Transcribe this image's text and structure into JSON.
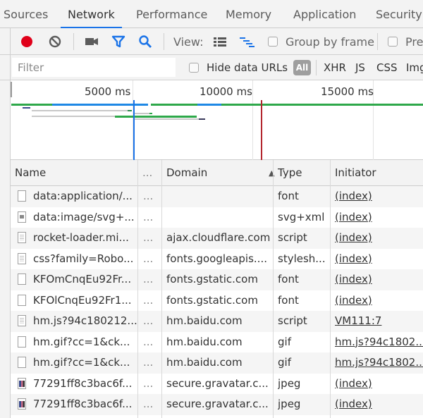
{
  "tabs": [
    {
      "label": "Sources",
      "active": false
    },
    {
      "label": "Network",
      "active": true
    },
    {
      "label": "Performance",
      "active": false
    },
    {
      "label": "Memory",
      "active": false
    },
    {
      "label": "Application",
      "active": false
    },
    {
      "label": "Security",
      "active": false
    }
  ],
  "toolbar": {
    "record_icon": "record-icon",
    "clear_icon": "clear-icon",
    "capture_icon": "camera-icon",
    "filter_icon": "filter-icon",
    "search_icon": "search-icon",
    "view_label": "View:",
    "large_rows_icon": "list-view-icon",
    "waterfall_icon": "waterfall-icon",
    "group_by_frame_label": "Group by frame",
    "group_by_frame_checked": false,
    "preserve_log_label": "Pre",
    "preserve_log_checked": false,
    "colors": {
      "record": "#e0001a",
      "accent": "#1a73e8"
    }
  },
  "filterbar": {
    "filter_placeholder": "Filter",
    "filter_value": "",
    "hide_data_urls_label": "Hide data URLs",
    "hide_data_urls_checked": false,
    "types": [
      "All",
      "XHR",
      "JS",
      "CSS",
      "Img"
    ],
    "selected_type": "All"
  },
  "overview": {
    "tick_labels": [
      "5000 ms",
      "10000 ms",
      "15000 ms"
    ],
    "dom_content_loaded_color": "#1a73e8",
    "load_color": "#b3262e"
  },
  "table": {
    "columns": [
      "Name",
      "...",
      "Domain",
      "Type",
      "Initiator"
    ],
    "sort_column": "Domain",
    "sort_direction": "ascending",
    "rows": [
      {
        "icon": "blank",
        "name": "data:application/...",
        "more": "...",
        "domain": "",
        "type": "font",
        "initiator": "(index)"
      },
      {
        "icon": "img",
        "name": "data:image/svg+...",
        "more": "...",
        "domain": "",
        "type": "svg+xml",
        "initiator": "(index)"
      },
      {
        "icon": "doc",
        "name": "rocket-loader.mi...",
        "more": "...",
        "domain": "ajax.cloudflare.com",
        "type": "script",
        "initiator": "(index)"
      },
      {
        "icon": "doc",
        "name": "css?family=Robo...",
        "more": "...",
        "domain": "fonts.googleapis....",
        "type": "stylesh...",
        "initiator": "(index)"
      },
      {
        "icon": "blank",
        "name": "KFOmCnqEu92Fr...",
        "more": "...",
        "domain": "fonts.gstatic.com",
        "type": "font",
        "initiator": "(index)"
      },
      {
        "icon": "blank",
        "name": "KFOlCnqEu92Fr1...",
        "more": "...",
        "domain": "fonts.gstatic.com",
        "type": "font",
        "initiator": "(index)"
      },
      {
        "icon": "doc",
        "name": "hm.js?94c180212...",
        "more": "...",
        "domain": "hm.baidu.com",
        "type": "script",
        "initiator": "VM111:7"
      },
      {
        "icon": "blank",
        "name": "hm.gif?cc=1&ck...",
        "more": "...",
        "domain": "hm.baidu.com",
        "type": "gif",
        "initiator": "hm.js?94c1802..."
      },
      {
        "icon": "blank",
        "name": "hm.gif?cc=1&ck...",
        "more": "...",
        "domain": "hm.baidu.com",
        "type": "gif",
        "initiator": "hm.js?94c1802..."
      },
      {
        "icon": "photo",
        "name": "77291ff8c3bac6f...",
        "more": "...",
        "domain": "secure.gravatar.c...",
        "type": "jpeg",
        "initiator": "(index)"
      },
      {
        "icon": "photo",
        "name": "77291ff8c3bac6f...",
        "more": "...",
        "domain": "secure.gravatar.c...",
        "type": "jpeg",
        "initiator": "(index)"
      }
    ]
  }
}
